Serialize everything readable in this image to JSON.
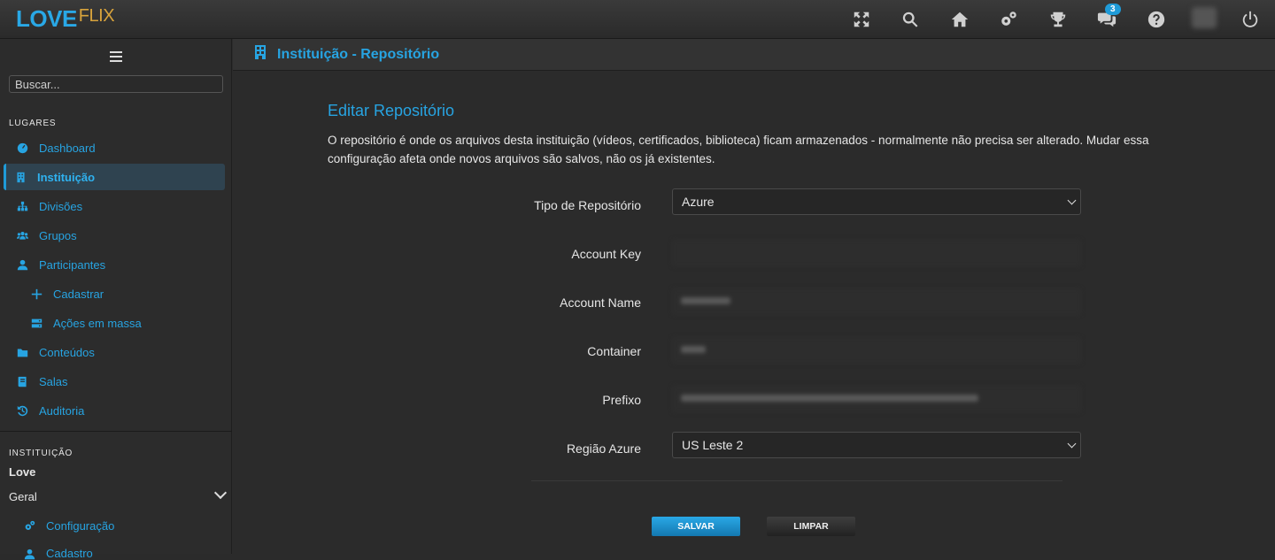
{
  "app": {
    "logo_love": "LOVE",
    "logo_flix": "FLIX"
  },
  "topbar": {
    "icons": [
      "fullscreen-icon",
      "search-icon",
      "home-icon",
      "settings-icon",
      "trophy-icon",
      "chat-icon",
      "help-icon",
      "avatar",
      "power-icon"
    ],
    "chat_badge": "3"
  },
  "sidebar": {
    "search_placeholder": "Buscar...",
    "section_places": "LUGARES",
    "items": [
      {
        "label": "Dashboard",
        "icon": "dashboard-icon"
      },
      {
        "label": "Instituição",
        "icon": "building-icon"
      },
      {
        "label": "Divisões",
        "icon": "sitemap-icon"
      },
      {
        "label": "Grupos",
        "icon": "users-icon"
      },
      {
        "label": "Participantes",
        "icon": "user-icon"
      },
      {
        "label": "Cadastrar",
        "icon": "plus-icon"
      },
      {
        "label": "Ações em massa",
        "icon": "server-icon"
      },
      {
        "label": "Conteúdos",
        "icon": "folder-icon"
      },
      {
        "label": "Salas",
        "icon": "book-icon"
      },
      {
        "label": "Auditoria",
        "icon": "history-icon"
      }
    ],
    "section_institution": "INSTITUIÇÃO",
    "institution_name": "Love",
    "geral_label": "Geral",
    "geral_items": [
      {
        "label": "Configuração",
        "icon": "cogs-icon"
      },
      {
        "label": "Cadastro",
        "icon": "user-icon"
      }
    ]
  },
  "page": {
    "header_title": "Instituição - Repositório",
    "form_title": "Editar Repositório",
    "description": "O repositório é onde os arquivos desta instituição (vídeos, certificados, biblioteca) ficam armazenados - normalmente não precisa ser alterado. Mudar essa configuração afeta onde novos arquivos são salvos, não os já existentes.",
    "fields": {
      "repo_type_label": "Tipo de Repositório",
      "repo_type_value": "Azure",
      "account_key_label": "Account Key",
      "account_name_label": "Account Name",
      "container_label": "Container",
      "prefix_label": "Prefixo",
      "region_label": "Região Azure",
      "region_value": "US Leste 2"
    },
    "save_label": "SALVAR",
    "clear_label": "LIMPAR"
  },
  "colors": {
    "accent": "#27a4e2",
    "background": "#2b2b2b",
    "logo_flix": "#d8a33c"
  }
}
